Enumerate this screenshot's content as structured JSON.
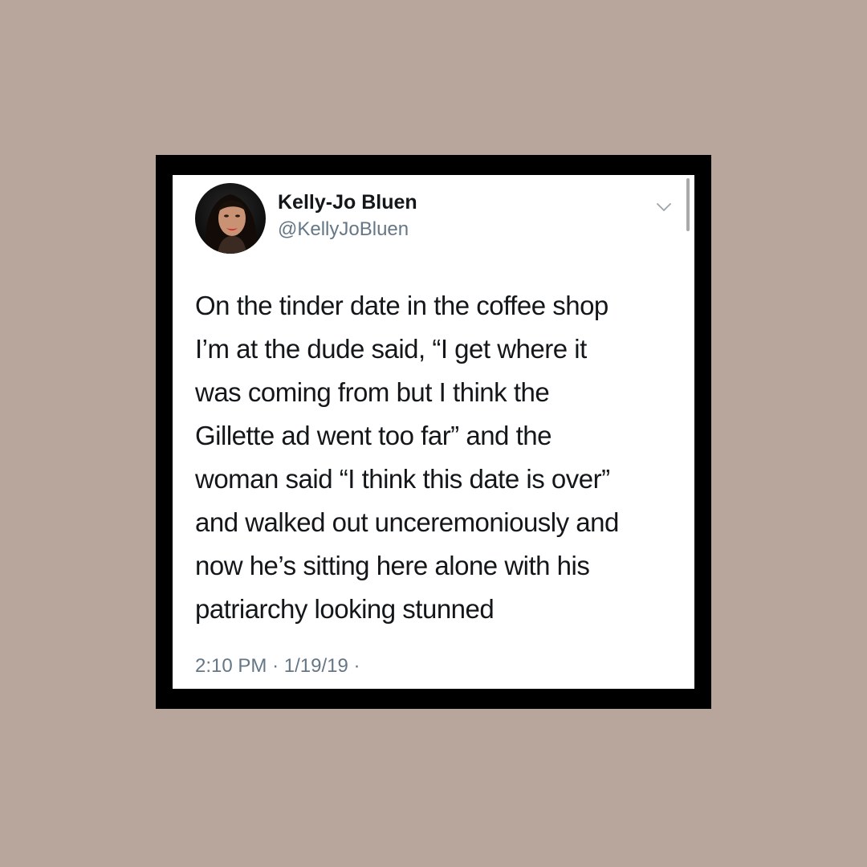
{
  "tweet": {
    "author": {
      "display_name": "Kelly-Jo Bluen",
      "handle": "@KellyJoBluen",
      "avatar_icon": "profile-photo"
    },
    "menu_icon": "chevron-down-icon",
    "text": "On the tinder date in the coffee shop\nI’m at the dude said, “I get where it\nwas coming from but I think the\nGillette ad went too far” and the\nwoman said “I think this date is over”\nand walked out unceremoniously and\nnow he’s sitting here alone with his\npatriarchy looking stunned",
    "time": "2:10 PM",
    "separator": "·",
    "date": "1/19/19",
    "trailing_separator": "·"
  },
  "colors": {
    "page_background": "#b8a69c",
    "frame": "#000000",
    "card": "#ffffff",
    "primary_text": "#14171a",
    "secondary_text": "#657786"
  }
}
